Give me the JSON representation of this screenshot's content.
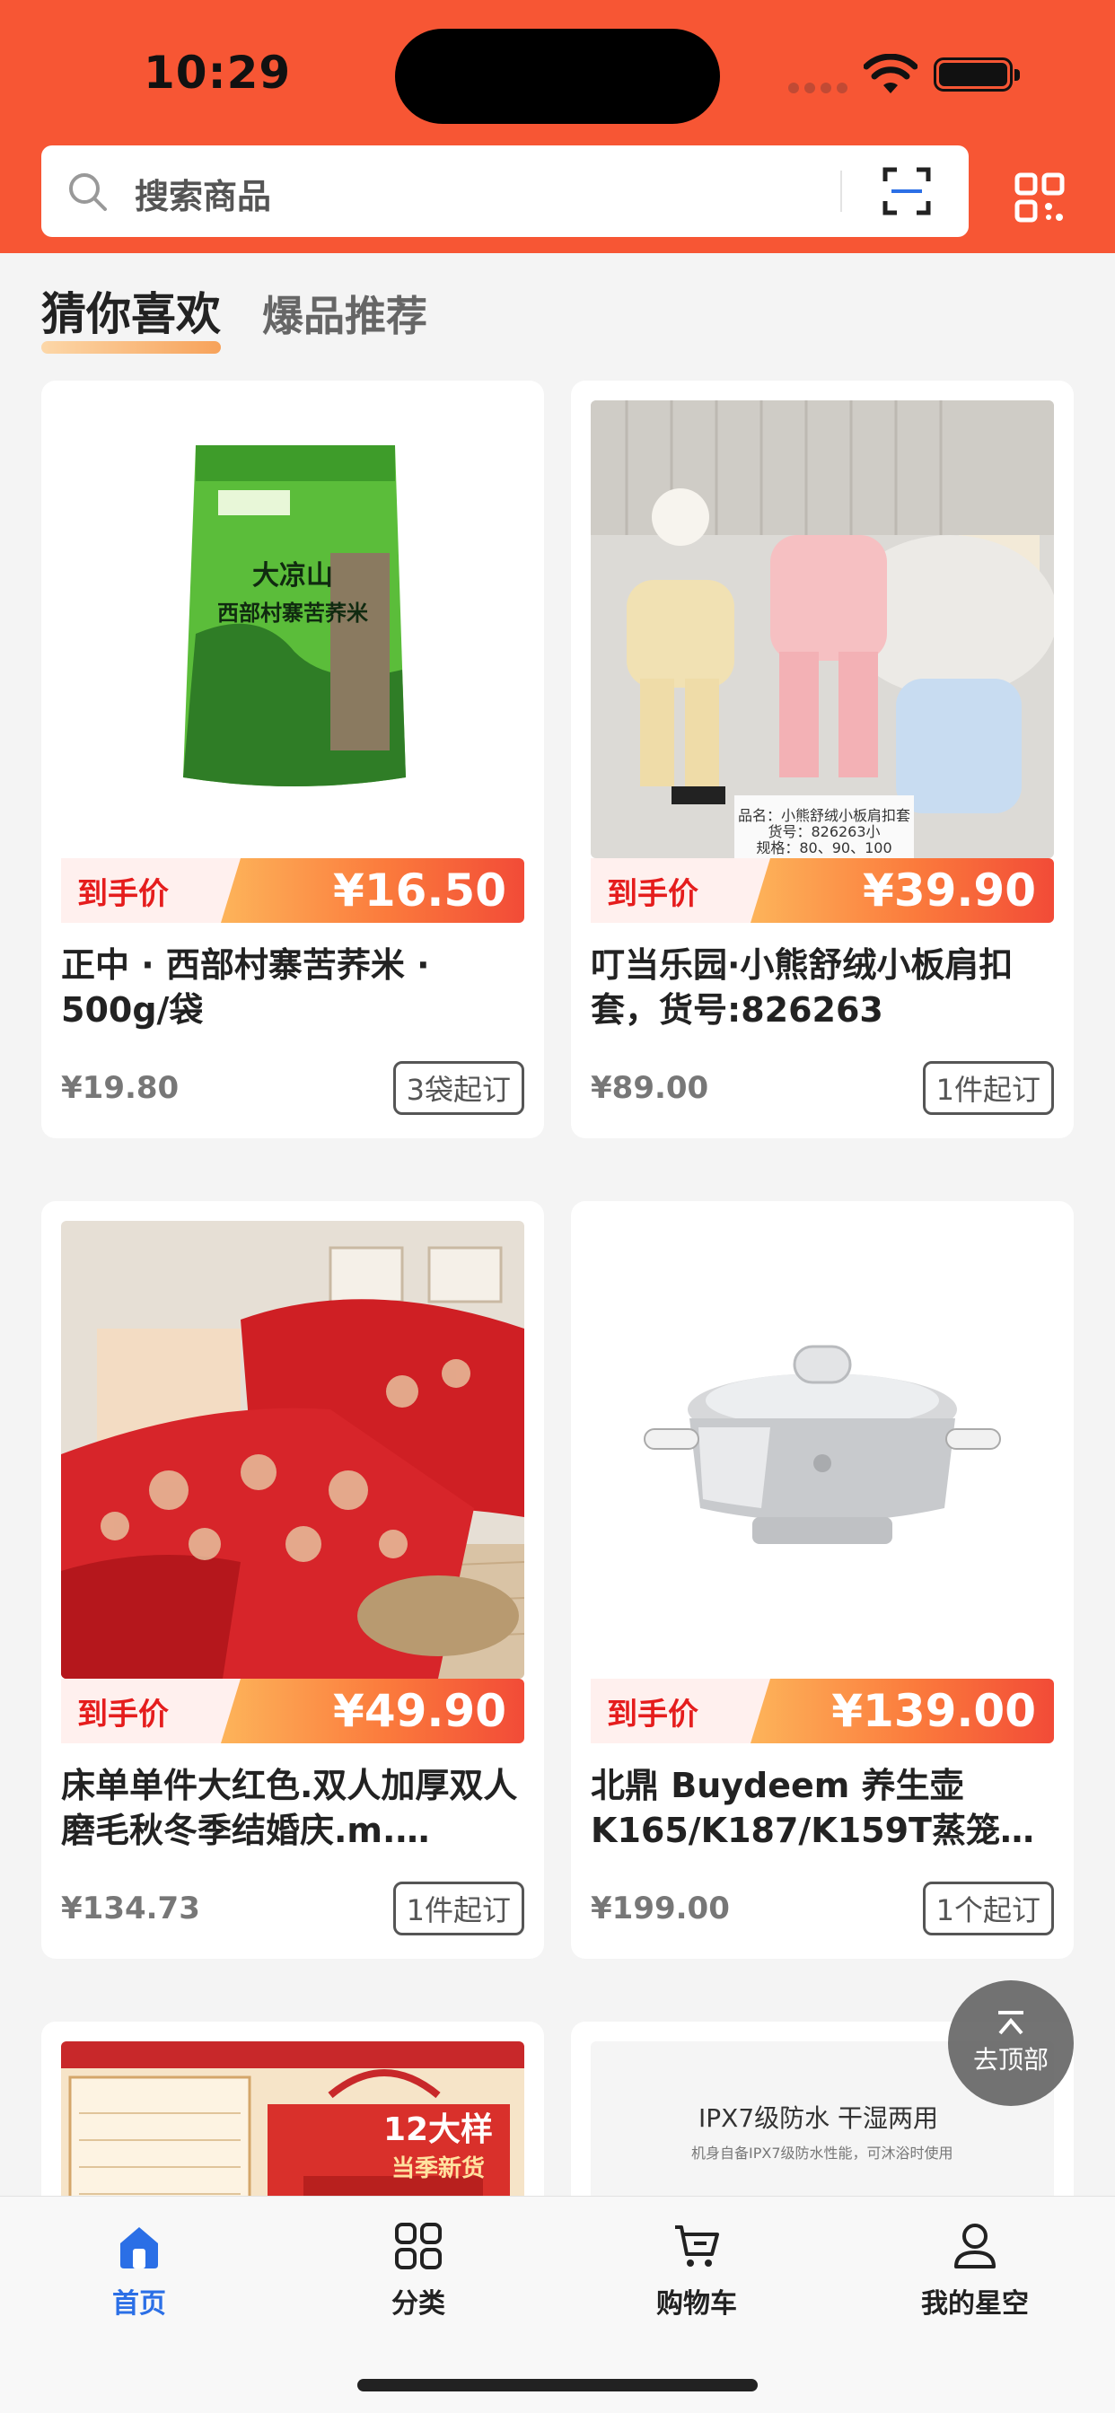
{
  "status_bar": {
    "time": "10:29"
  },
  "search": {
    "placeholder": "搜索商品"
  },
  "tabs": [
    {
      "label": "猜你喜欢",
      "active": true
    },
    {
      "label": "爆品推荐",
      "active": false
    }
  ],
  "price_tag": "到手价",
  "products": [
    {
      "price": "¥16.50",
      "title": "正中 · 西部村寨苦荞米 · 500g/袋",
      "original_price": "¥19.80",
      "min_order": "3袋起订",
      "image": "green-bag-product",
      "pkg_line1": "大凉山",
      "pkg_line2": "西部村寨苦荞米"
    },
    {
      "price": "¥39.90",
      "title": "叮当乐园·小熊舒绒小板肩扣套，货号:826263",
      "original_price": "¥89.00",
      "min_order": "1件起订",
      "image": "baby-clothes-product",
      "caption1": "品名：小熊舒绒小板肩扣套",
      "caption2": "货号：826263小",
      "caption3": "规格：80、90、100"
    },
    {
      "price": "¥49.90",
      "title": "床单单件大红色.双人加厚双人磨毛秋冬季结婚庆.m.…",
      "original_price": "¥134.73",
      "min_order": "1件起订",
      "image": "red-bedsheet-product"
    },
    {
      "price": "¥139.00",
      "title": "北鼎 Buydeem 养生壶 K165/K187/K159T蒸笼A…",
      "original_price": "¥199.00",
      "min_order": "1个起订",
      "image": "steel-pot-product"
    },
    {
      "image": "gift-box-product",
      "promo_line1": "12大样",
      "promo_line2": "当季新货"
    },
    {
      "image": "waterproof-product",
      "promo_title": "IPX7级防水 干湿两用",
      "promo_sub": "机身自备IPX7级防水性能，可沐浴时使用"
    }
  ],
  "back_to_top": "去顶部",
  "tab_bar": [
    {
      "label": "首页",
      "icon": "home-icon",
      "active": true
    },
    {
      "label": "分类",
      "icon": "category-icon",
      "active": false
    },
    {
      "label": "购物车",
      "icon": "cart-icon",
      "active": false
    },
    {
      "label": "我的星空",
      "icon": "profile-icon",
      "active": false
    }
  ],
  "colors": {
    "header": "#f75634",
    "price_red": "#e51d1d",
    "active_tab": "#2b6fe6"
  }
}
